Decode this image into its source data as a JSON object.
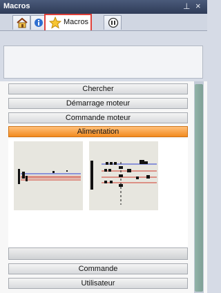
{
  "window": {
    "title": "Macros"
  },
  "tabs": [
    {
      "name": "home",
      "label": ""
    },
    {
      "name": "info",
      "label": ""
    },
    {
      "name": "macros",
      "label": "Macros",
      "selected": true
    },
    {
      "name": "tools",
      "label": ""
    }
  ],
  "categories": {
    "chercher": "Chercher",
    "demarrage_moteur": "Démarrage moteur",
    "commande_moteur": "Commande moteur",
    "alimentation": "Alimentation",
    "commande": "Commande",
    "utilisateur": "Utilisateur"
  },
  "colors": {
    "active_category": "#f28a1e",
    "selected_tab_border": "#e0413a",
    "wire_blue": "#2b3fd0",
    "wire_red": "#d03a2b"
  },
  "icons": {
    "home": "home-icon",
    "info": "info-icon",
    "star": "star-icon",
    "tools": "tools-icon",
    "pin": "pin-icon",
    "close": "close-icon"
  }
}
